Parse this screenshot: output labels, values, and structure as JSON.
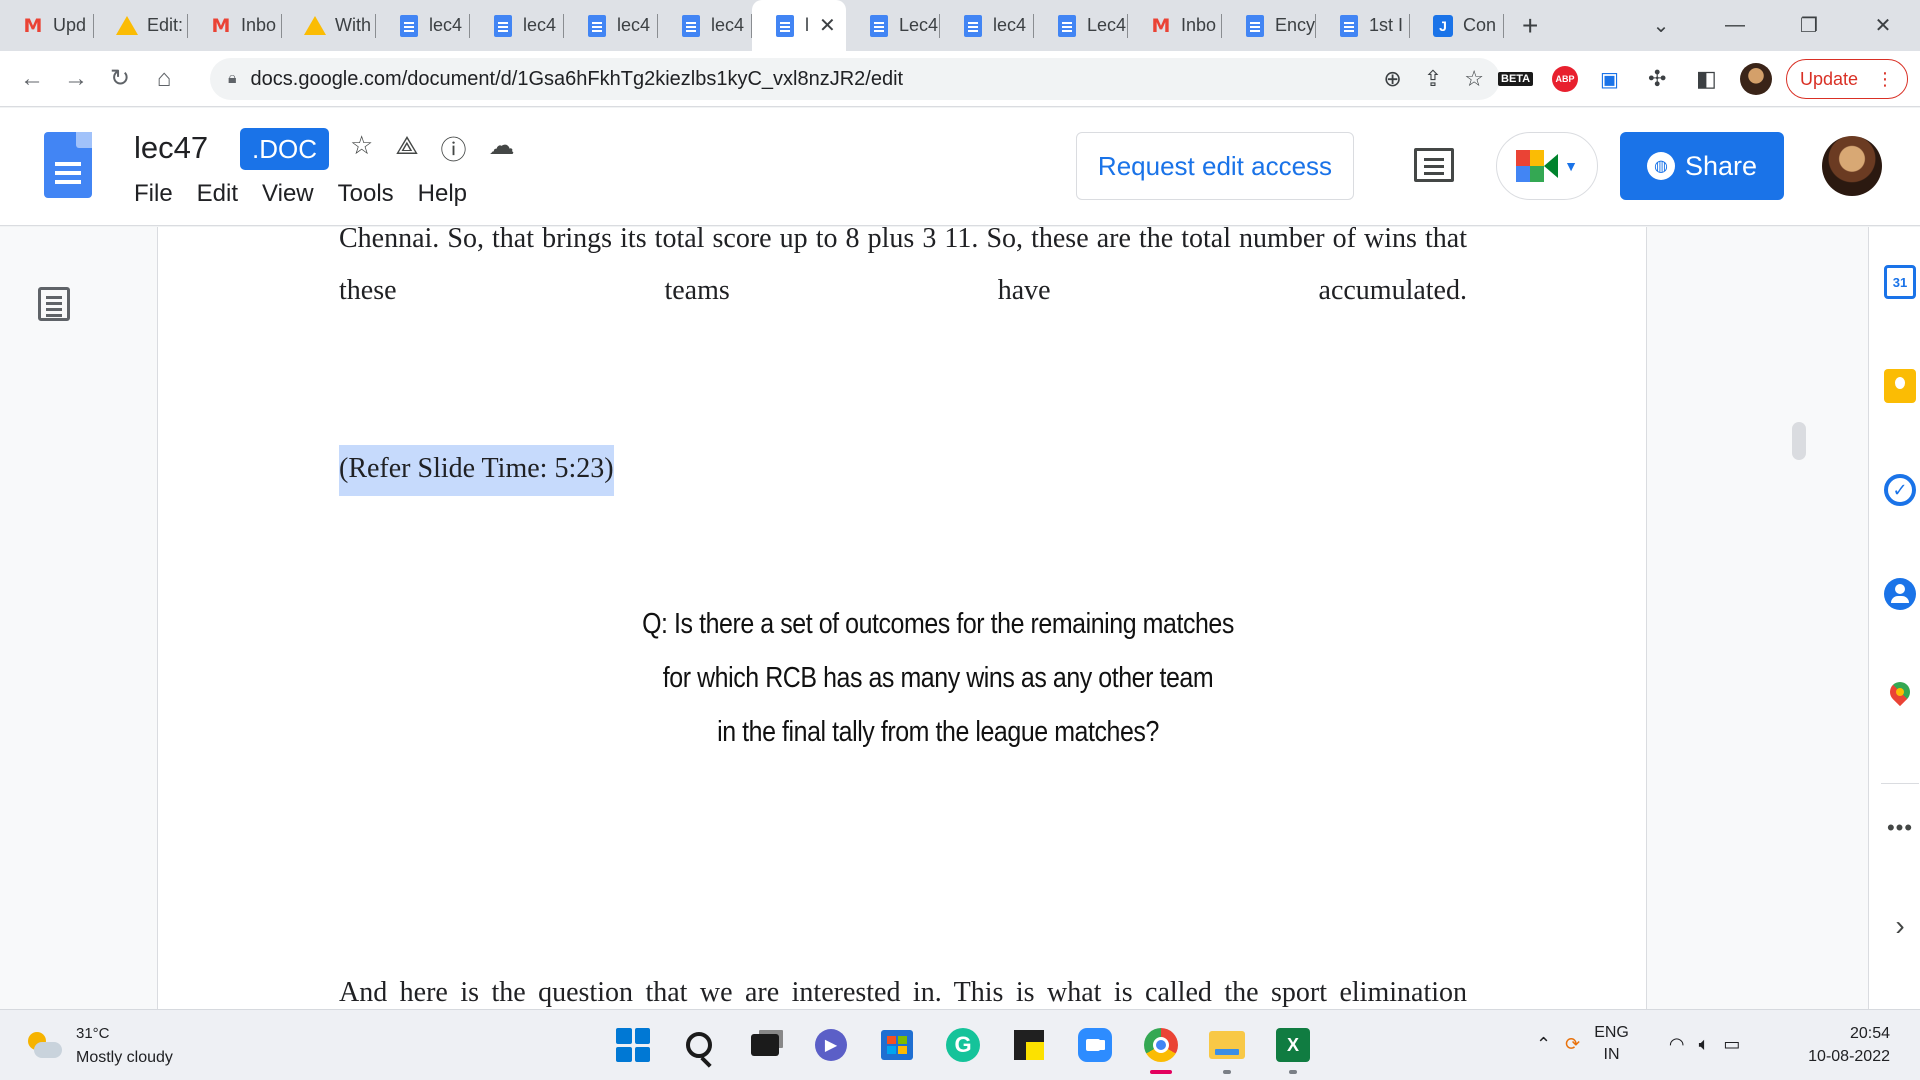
{
  "browser": {
    "tabs": [
      {
        "label": "Upd",
        "icon": "gmail-icon"
      },
      {
        "label": "Edit:",
        "icon": "drive-icon"
      },
      {
        "label": "Inbo",
        "icon": "gmail-icon"
      },
      {
        "label": "With",
        "icon": "drive-icon"
      },
      {
        "label": "lec4",
        "icon": "docs-icon"
      },
      {
        "label": "lec4",
        "icon": "docs-icon"
      },
      {
        "label": "lec4",
        "icon": "docs-icon"
      },
      {
        "label": "lec4",
        "icon": "docs-icon"
      },
      {
        "label": "l",
        "icon": "docs-icon",
        "active": true,
        "close": "✕"
      },
      {
        "label": "Lec4",
        "icon": "docs-icon"
      },
      {
        "label": "lec4",
        "icon": "docs-icon"
      },
      {
        "label": "Lec4",
        "icon": "docs-icon"
      },
      {
        "label": "Inbo",
        "icon": "gmail-icon"
      },
      {
        "label": "Ency",
        "icon": "docs-icon"
      },
      {
        "label": "1st I",
        "icon": "docs-icon"
      },
      {
        "label": "Con",
        "icon": "j-icon"
      }
    ],
    "new_tab": "+",
    "url": "docs.google.com/document/d/1Gsa6hFkhTg2kiezlbs1kyC_vxl8nzJR2/edit",
    "extension_beta": "BETA",
    "extension_abp": "ABP",
    "update_label": "Update"
  },
  "docs": {
    "title": "lec47",
    "badge": ".DOC",
    "menu": [
      "File",
      "Edit",
      "View",
      "Tools",
      "Help"
    ],
    "request_edit": "Request edit access",
    "share": "Share"
  },
  "document": {
    "para1": "Chennai. So, that brings its total score up to 8 plus 3 11. So, these are the total number of wins that these teams have accumulated.",
    "para2": "(Refer Slide Time: 5:23)",
    "slide_lines": [
      "Q: Is there a set of outcomes for the remaining matches",
      "for which RCB has as many wins as any other team",
      "in the final tally from the league matches?"
    ],
    "para3": "And here is the question that we are interested in. This is what is called the sport elimination"
  },
  "side_panel": {
    "calendar_day": "31"
  },
  "taskbar": {
    "temperature": "31°C",
    "weather": "Mostly cloudy",
    "lang_top": "ENG",
    "lang_bottom": "IN",
    "time": "20:54",
    "date": "10-08-2022"
  },
  "colors": {
    "accent": "#1a73e8",
    "highlight": "#c6dafc",
    "update_red": "#d93025"
  }
}
